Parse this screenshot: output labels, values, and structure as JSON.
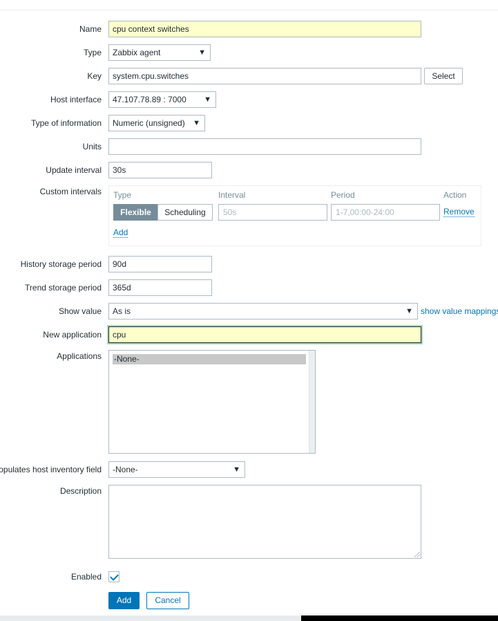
{
  "form": {
    "name": {
      "label": "Name",
      "value": "cpu context switches"
    },
    "type": {
      "label": "Type",
      "value": "Zabbix agent"
    },
    "key": {
      "label": "Key",
      "value": "system.cpu.switches",
      "button": "Select"
    },
    "host_interface": {
      "label": "Host interface",
      "value": "47.107.78.89 : 7000"
    },
    "type_of_information": {
      "label": "Type of information",
      "value": "Numeric (unsigned)"
    },
    "units": {
      "label": "Units",
      "value": ""
    },
    "update_interval": {
      "label": "Update interval",
      "value": "30s"
    },
    "custom_intervals": {
      "label": "Custom intervals",
      "headers": {
        "type": "Type",
        "interval": "Interval",
        "period": "Period",
        "action": "Action"
      },
      "row": {
        "type_options": [
          "Flexible",
          "Scheduling"
        ],
        "selected_type": "Flexible",
        "interval_placeholder": "50s",
        "period_placeholder": "1-7,00:00-24:00",
        "remove": "Remove"
      },
      "add": "Add"
    },
    "history_storage_period": {
      "label": "History storage period",
      "value": "90d"
    },
    "trend_storage_period": {
      "label": "Trend storage period",
      "value": "365d"
    },
    "show_value": {
      "label": "Show value",
      "value": "As is",
      "link": "show value mappings"
    },
    "new_application": {
      "label": "New application",
      "value": "cpu"
    },
    "applications": {
      "label": "Applications",
      "options": [
        "-None-"
      ]
    },
    "inventory_field": {
      "label": "opulates host inventory field",
      "value": "-None-"
    },
    "description": {
      "label": "Description",
      "value": ""
    },
    "enabled": {
      "label": "Enabled",
      "checked": true
    }
  },
  "actions": {
    "add": "Add",
    "cancel": "Cancel"
  },
  "colors": {
    "primary": "#0275b8",
    "highlight_field": "#ffffcc",
    "focus_ring": "#a6d7b4"
  },
  "icons": {
    "dropdown": "triangle-down",
    "check": "checkmark"
  }
}
